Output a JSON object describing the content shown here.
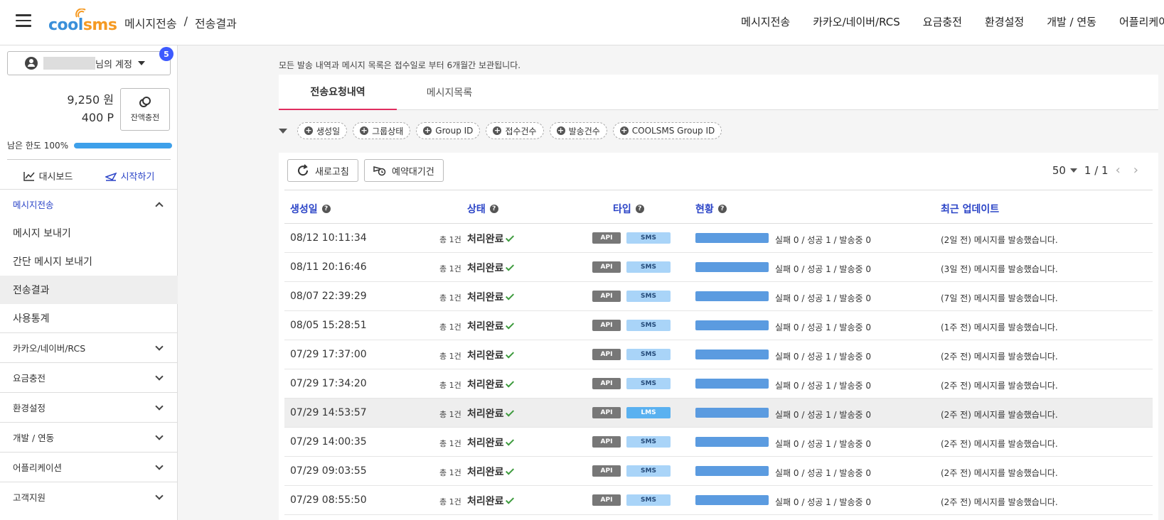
{
  "header": {
    "logo_left": "cool",
    "logo_right": "sms",
    "breadcrumb": [
      "메시지전송",
      "/",
      "전송결과"
    ],
    "nav": [
      "메시지전송",
      "카카오/네이버/RCS",
      "요금충전",
      "환경설정",
      "개발 / 연동",
      "어플리케이"
    ]
  },
  "sidebar": {
    "account_suffix": "님의 계정",
    "notification_count": "5",
    "balance_won": "9,250 원",
    "balance_point": "400 P",
    "charge_label": "잔액충전",
    "limit_label": "남은 한도 100%",
    "limit_fraction": 1.0,
    "dashboard_label": "대시보드",
    "start_label": "시작하기",
    "open_section": "메시지전송",
    "sub_items": [
      "메시지 보내기",
      "간단 메시지 보내기",
      "전송결과",
      "사용통계"
    ],
    "active_sub": "전송결과",
    "sections": [
      "카카오/네이버/RCS",
      "요금충전",
      "환경설정",
      "개발 / 연동",
      "어플리케이션",
      "고객지원"
    ]
  },
  "main": {
    "notice": "모든 발송 내역과 메시지 목록은 접수일로 부터 6개월간 보관됩니다.",
    "tabs": [
      "전송요청내역",
      "메시지목록"
    ],
    "active_tab": "전송요청내역",
    "filters": [
      "생성일",
      "그룹상태",
      "Group ID",
      "접수건수",
      "발송건수",
      "COOLSMS Group ID"
    ],
    "refresh_label": "새로고침",
    "reserved_label": "예약대기건",
    "page_size": "50",
    "page_indicator": "1 / 1",
    "columns": [
      "생성일",
      "상태",
      "타입",
      "현황",
      "최근 업데이트"
    ],
    "rows": [
      {
        "date": "08/12 10:11:34",
        "count": "총 1건",
        "status": "처리완료",
        "api": "API",
        "type": "SMS",
        "stat": "실패 0 / 성공 1 / 발송중 0",
        "update": "(2일 전) 메시지를 발송했습니다."
      },
      {
        "date": "08/11 20:16:46",
        "count": "총 1건",
        "status": "처리완료",
        "api": "API",
        "type": "SMS",
        "stat": "실패 0 / 성공 1 / 발송중 0",
        "update": "(3일 전) 메시지를 발송했습니다."
      },
      {
        "date": "08/07 22:39:29",
        "count": "총 1건",
        "status": "처리완료",
        "api": "API",
        "type": "SMS",
        "stat": "실패 0 / 성공 1 / 발송중 0",
        "update": "(7일 전) 메시지를 발송했습니다."
      },
      {
        "date": "08/05 15:28:51",
        "count": "총 1건",
        "status": "처리완료",
        "api": "API",
        "type": "SMS",
        "stat": "실패 0 / 성공 1 / 발송중 0",
        "update": "(1주 전) 메시지를 발송했습니다."
      },
      {
        "date": "07/29 17:37:00",
        "count": "총 1건",
        "status": "처리완료",
        "api": "API",
        "type": "SMS",
        "stat": "실패 0 / 성공 1 / 발송중 0",
        "update": "(2주 전) 메시지를 발송했습니다."
      },
      {
        "date": "07/29 17:34:20",
        "count": "총 1건",
        "status": "처리완료",
        "api": "API",
        "type": "SMS",
        "stat": "실패 0 / 성공 1 / 발송중 0",
        "update": "(2주 전) 메시지를 발송했습니다."
      },
      {
        "date": "07/29 14:53:57",
        "count": "총 1건",
        "status": "처리완료",
        "api": "API",
        "type": "LMS",
        "stat": "실패 0 / 성공 1 / 발송중 0",
        "update": "(2주 전) 메시지를 발송했습니다."
      },
      {
        "date": "07/29 14:00:35",
        "count": "총 1건",
        "status": "처리완료",
        "api": "API",
        "type": "SMS",
        "stat": "실패 0 / 성공 1 / 발송중 0",
        "update": "(2주 전) 메시지를 발송했습니다."
      },
      {
        "date": "07/29 09:03:55",
        "count": "총 1건",
        "status": "처리완료",
        "api": "API",
        "type": "SMS",
        "stat": "실패 0 / 성공 1 / 발송중 0",
        "update": "(2주 전) 메시지를 발송했습니다."
      },
      {
        "date": "07/29 08:55:50",
        "count": "총 1건",
        "status": "처리완료",
        "api": "API",
        "type": "SMS",
        "stat": "실패 0 / 성공 1 / 발송중 0",
        "update": "(2주 전) 메시지를 발송했습니다."
      }
    ],
    "highlighted_row": 6
  },
  "colors": {
    "accent": "#2b44c7",
    "tab_underline": "#e02d5f",
    "progress": "#5b9be0",
    "badge": "#3d5afe"
  }
}
